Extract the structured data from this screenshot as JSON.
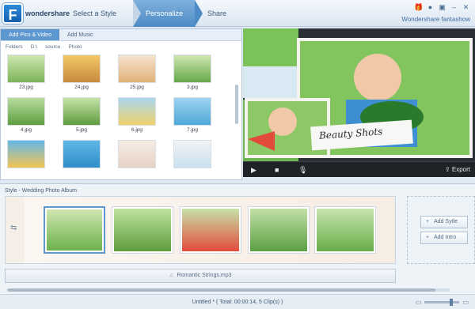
{
  "header": {
    "logo_text": "wondershare",
    "brand": "Wondershare fantashow",
    "steps": [
      "Select a Style",
      "Personalize",
      "Share"
    ]
  },
  "library": {
    "tabs": [
      "Add Pics & Video",
      "Add Music"
    ],
    "breadcrumb": [
      "Folders",
      "D:\\",
      "source",
      "Photo"
    ],
    "files": [
      "23.jpg",
      "24.jpg",
      "25.jpg",
      "3.jpg",
      "4.jpg",
      "5.jpg",
      "6.jpg",
      "7.jpg",
      "",
      "",
      "",
      ""
    ]
  },
  "preview": {
    "caption": "Beauty Shots",
    "export_label": "Export"
  },
  "storyboard": {
    "style_title": "Style - Wedding Photo Album",
    "add_style": "Add Sytle",
    "add_intro": "Add Intro",
    "music": "Romantic Strings.mp3",
    "status": "Untitled *  ( Total: 00:00:14, 5 Clip(s) )"
  },
  "icons": {
    "play": "play-icon",
    "stop": "stop-icon",
    "mic": "microphone-icon",
    "export": "export-icon"
  },
  "colors": {
    "accent": "#5c97cf",
    "dark": "#1f2226"
  }
}
